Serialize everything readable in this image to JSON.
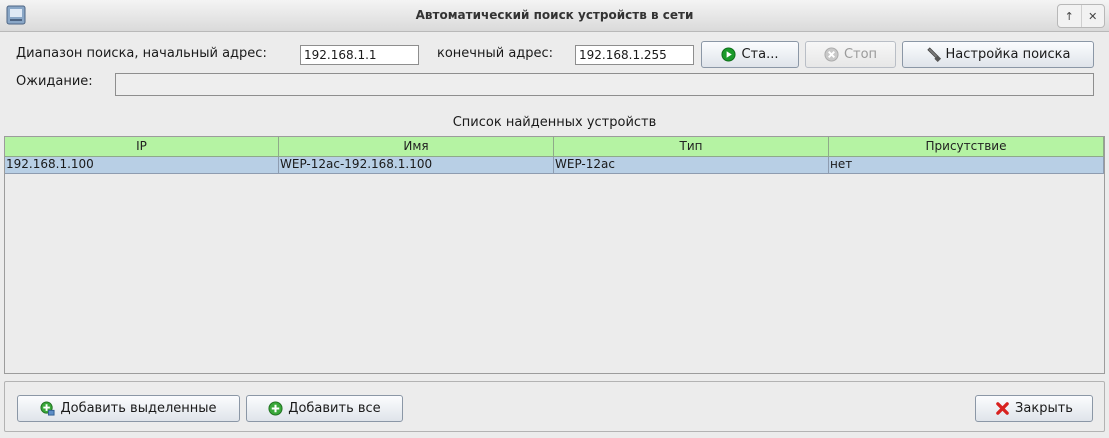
{
  "window": {
    "title": "Автоматический поиск устройств в сети",
    "wm_buttons": [
      "↑",
      "✕"
    ]
  },
  "search": {
    "range_label": "Диапазон поиска, начальный адрес:",
    "start_address": "192.168.1.1",
    "end_label": "конечный адрес:",
    "end_address": "192.168.1.255",
    "start_button": "Ста...",
    "stop_button": "Стоп",
    "settings_button": "Настройка поиска",
    "waiting_label": "Ожидание:"
  },
  "devices": {
    "title": "Список найденных устройств",
    "columns": [
      "IP",
      "Имя",
      "Тип",
      "Присутствие"
    ],
    "rows": [
      [
        "192.168.1.100",
        "WEP-12ac-192.168.1.100",
        "WEP-12ac",
        "нет"
      ]
    ]
  },
  "actions": {
    "add_selected": "Добавить выделенные",
    "add_all": "Добавить все",
    "close": "Закрыть"
  },
  "colors": {
    "header_bg": "#b5f3a3",
    "selected_row": "#b8cfe5",
    "start_icon": "#1a9a2a",
    "close_icon": "#d8211f"
  }
}
